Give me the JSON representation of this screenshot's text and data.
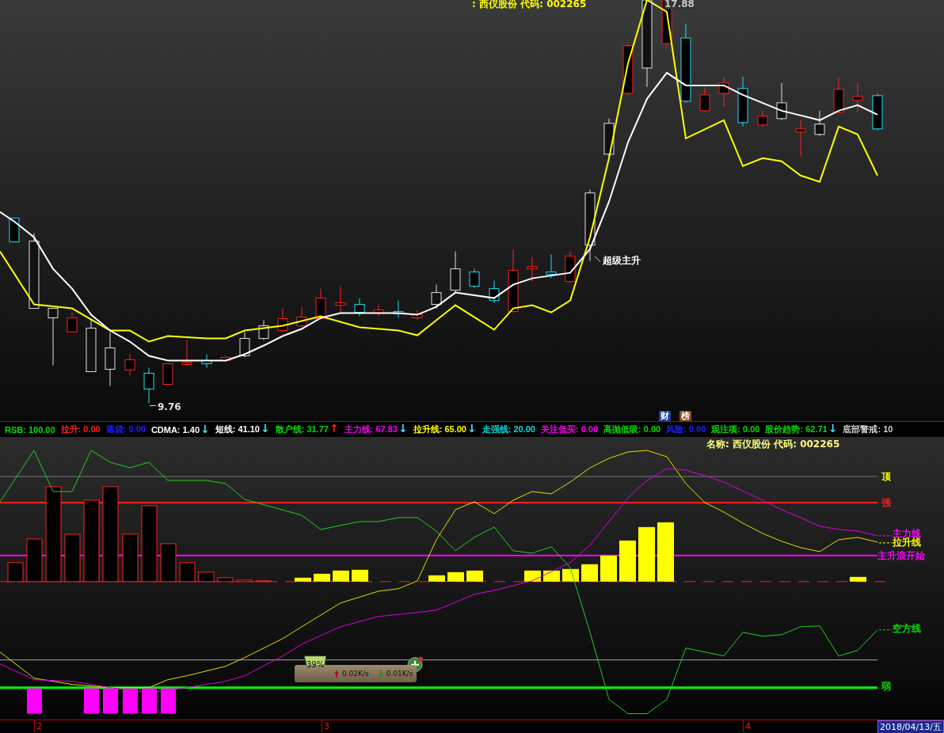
{
  "main_chart": {
    "title": ": 西仪股份 代码: 002265",
    "high_label": "17.88",
    "low_label": "9.76",
    "annotation": "超级主升",
    "badges": [
      {
        "text": "财",
        "color": "#1c3f9e"
      },
      {
        "text": "榜",
        "color": "#8a4b1c"
      }
    ]
  },
  "indicator_bar": [
    {
      "text": "RSB: 100.00",
      "color": "#00e000"
    },
    {
      "text": "拉升: 0.00",
      "color": "#ff2020"
    },
    {
      "text": "落袋: 0.00",
      "color": "#2020ff"
    },
    {
      "text": "CDMA: 1.40",
      "color": "#ffffff",
      "arrow": {
        "text": "↓",
        "color": "#40e0ff"
      }
    },
    {
      "text": "短线: 41.10",
      "color": "#ffffff",
      "arrow": {
        "text": "↓",
        "color": "#40e0ff"
      }
    },
    {
      "text": "散户线: 31.77",
      "color": "#00e000",
      "arrow": {
        "text": "↑",
        "color": "#ff2020"
      }
    },
    {
      "text": "主力线: 67.83",
      "color": "#ff00ff",
      "arrow": {
        "text": "↓",
        "color": "#40e0ff"
      }
    },
    {
      "text": "拉升线: 65.00",
      "color": "#ffff00",
      "arrow": {
        "text": "↓",
        "color": "#40e0ff"
      }
    },
    {
      "text": "走强线: 20.00",
      "color": "#00e0e0"
    },
    {
      "text": "关注低买: 0.00",
      "color": "#ff00ff"
    },
    {
      "text": "高抛低吸: 0.00",
      "color": "#00e000"
    },
    {
      "text": "风险: 0.00",
      "color": "#2020ff"
    },
    {
      "text": "观注项: 0.00",
      "color": "#00e000"
    },
    {
      "text": "股价趋势: 62.71",
      "color": "#00e000",
      "arrow": {
        "text": "↓",
        "color": "#40e0ff"
      }
    },
    {
      "text": "底部警戒: 10",
      "color": "#d0d0d0"
    }
  ],
  "sub_chart": {
    "title": "名称: 西仪股份 代码: 002265",
    "labels": [
      {
        "text": "顶",
        "color": "#ffff00",
        "kind": "level"
      },
      {
        "text": "强",
        "color": "#ff2020",
        "kind": "level"
      },
      {
        "text": "主力线",
        "color": "#ff00ff",
        "kind": "line"
      },
      {
        "text": "拉升线",
        "color": "#ffff00",
        "kind": "line"
      },
      {
        "text": "主升浪开始",
        "color": "#ff00ff",
        "kind": "level"
      },
      {
        "text": "空方线",
        "color": "#00e000",
        "kind": "line"
      },
      {
        "text": "弱",
        "color": "#00e000",
        "kind": "level"
      }
    ]
  },
  "network_widget": {
    "percent": "39%",
    "upload": "0.02K/s",
    "download": "0.01K/s"
  },
  "time_axis": {
    "labels": [
      "2",
      "3",
      "4"
    ],
    "date": "2018/04/13/五"
  }
}
